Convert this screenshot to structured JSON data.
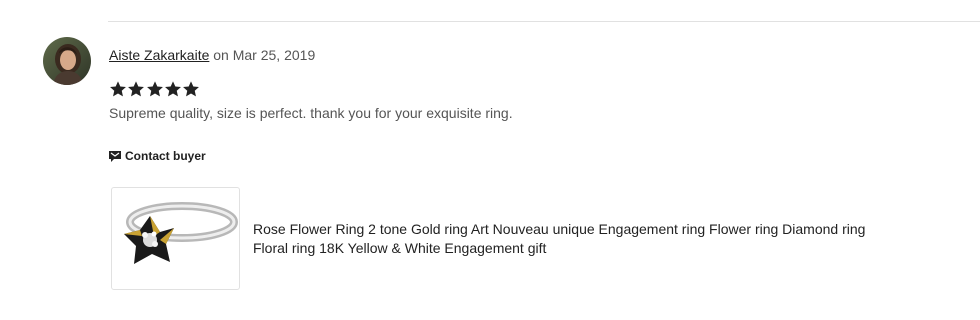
{
  "review": {
    "reviewer_name": "Aiste Zakarkaite",
    "date_text": "on Mar 25, 2019",
    "rating": 5,
    "rating_max": 5,
    "text": "Supreme quality, size is perfect. thank you for your exquisite ring.",
    "contact_label": "Contact buyer"
  },
  "product": {
    "title": "Rose Flower Ring 2 tone Gold ring Art Nouveau unique Engagement ring Flower ring Diamond ring Floral ring 18K Yellow & White Engagement gift"
  },
  "colors": {
    "star": "#222222",
    "divider": "#e1e1e1",
    "text_muted": "#555555",
    "text_dark": "#222222"
  },
  "icons": {
    "star": "star-icon",
    "contact": "message-flag-icon"
  }
}
